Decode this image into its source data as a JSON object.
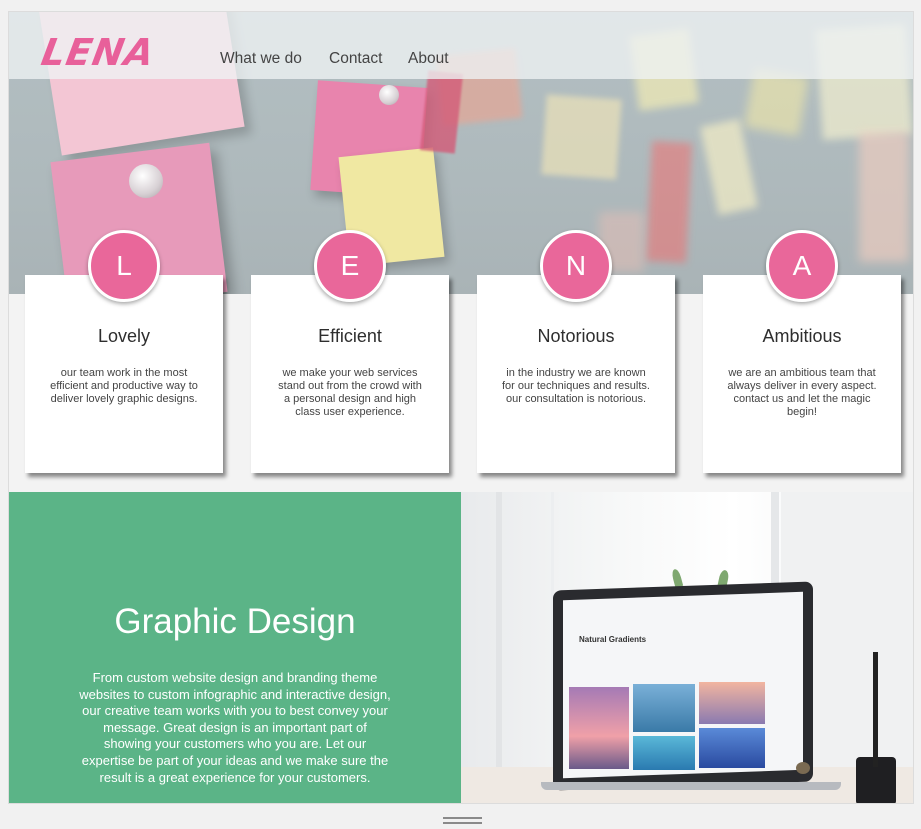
{
  "brand": {
    "logo": "LENA"
  },
  "nav": {
    "items": [
      "What we do",
      "Contact",
      "About"
    ]
  },
  "cards": [
    {
      "letter": "L",
      "title": "Lovely",
      "text": "our team work in the most efficient and productive way to deliver lovely graphic designs."
    },
    {
      "letter": "E",
      "title": "Efficient",
      "text": "we make your web services stand out from the crowd with a personal design and high class user experience."
    },
    {
      "letter": "N",
      "title": "Notorious",
      "text": "in the industry we are known for our techniques and results. our consultation is notorious."
    },
    {
      "letter": "A",
      "title": "Ambitious",
      "text": "we are an ambitious team that always deliver in every aspect. contact us and let the magic begin!"
    }
  ],
  "feature": {
    "title": "Graphic Design",
    "text": "From custom website design and branding theme websites to custom infographic and interactive design, our creative team works with you to best convey your message. Great design is an important part of showing your customers who you are. Let our expertise be part of your ideas and we make sure the result is a great experience for your customers."
  },
  "screen": {
    "heading": "Natural Gradients"
  },
  "colors": {
    "accent": "#e9679a",
    "green": "#5bb487",
    "logo": "#e8609a"
  }
}
